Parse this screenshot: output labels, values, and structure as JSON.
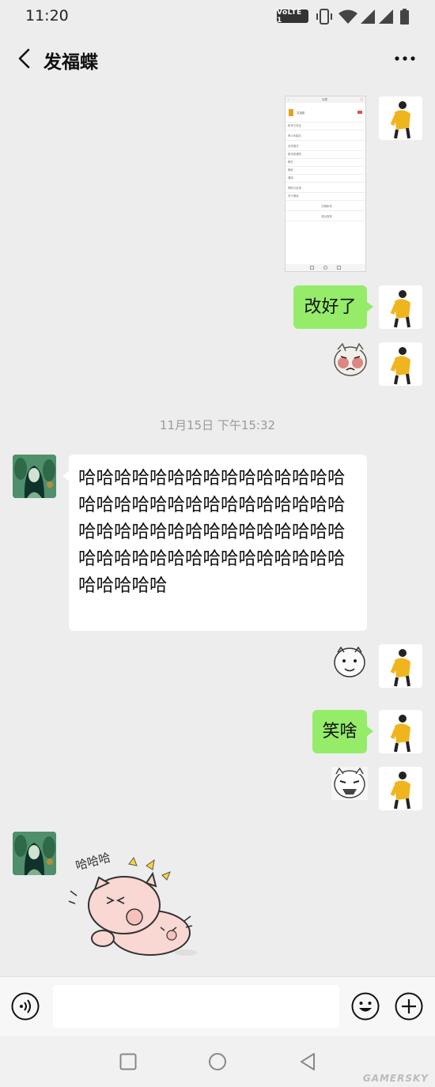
{
  "status_bar": {
    "time": "11:20",
    "network_badge": "VoLTE 1"
  },
  "header": {
    "title": "发福蝶"
  },
  "messages": {
    "screenshot_thumb": {
      "title": "设置",
      "account_name": "发福蝶",
      "rows": [
        "帐号与安全",
        "青少年模式",
        "关怀模式",
        "新消息通知",
        "聊天",
        "隐私",
        "通用",
        "帮助与反馈",
        "关于微信"
      ],
      "buttons": [
        "切换帐号",
        "退出登录"
      ]
    },
    "m2": "改好了",
    "timestamp": "11月15日 下午15:32",
    "m4": "哈哈哈哈哈哈哈哈哈哈哈哈哈哈哈哈哈哈哈哈哈哈哈哈哈哈哈哈哈哈哈哈哈哈哈哈哈哈哈哈哈哈哈哈哈哈哈哈哈哈哈哈哈哈哈哈哈哈哈哈哈哈哈哈哈",
    "m6": "笑啥",
    "pig_sticker_text": "哈哈哈"
  },
  "input": {
    "placeholder": ""
  },
  "watermark": "GAMERSKY",
  "colors": {
    "bg": "#ededed",
    "bubble_self": "#95ec69",
    "bubble_other": "#ffffff"
  },
  "icons": [
    "back-icon",
    "more-icon",
    "voice-icon",
    "emoji-icon",
    "plus-icon",
    "nav-back-icon",
    "nav-home-icon",
    "nav-recent-icon"
  ]
}
